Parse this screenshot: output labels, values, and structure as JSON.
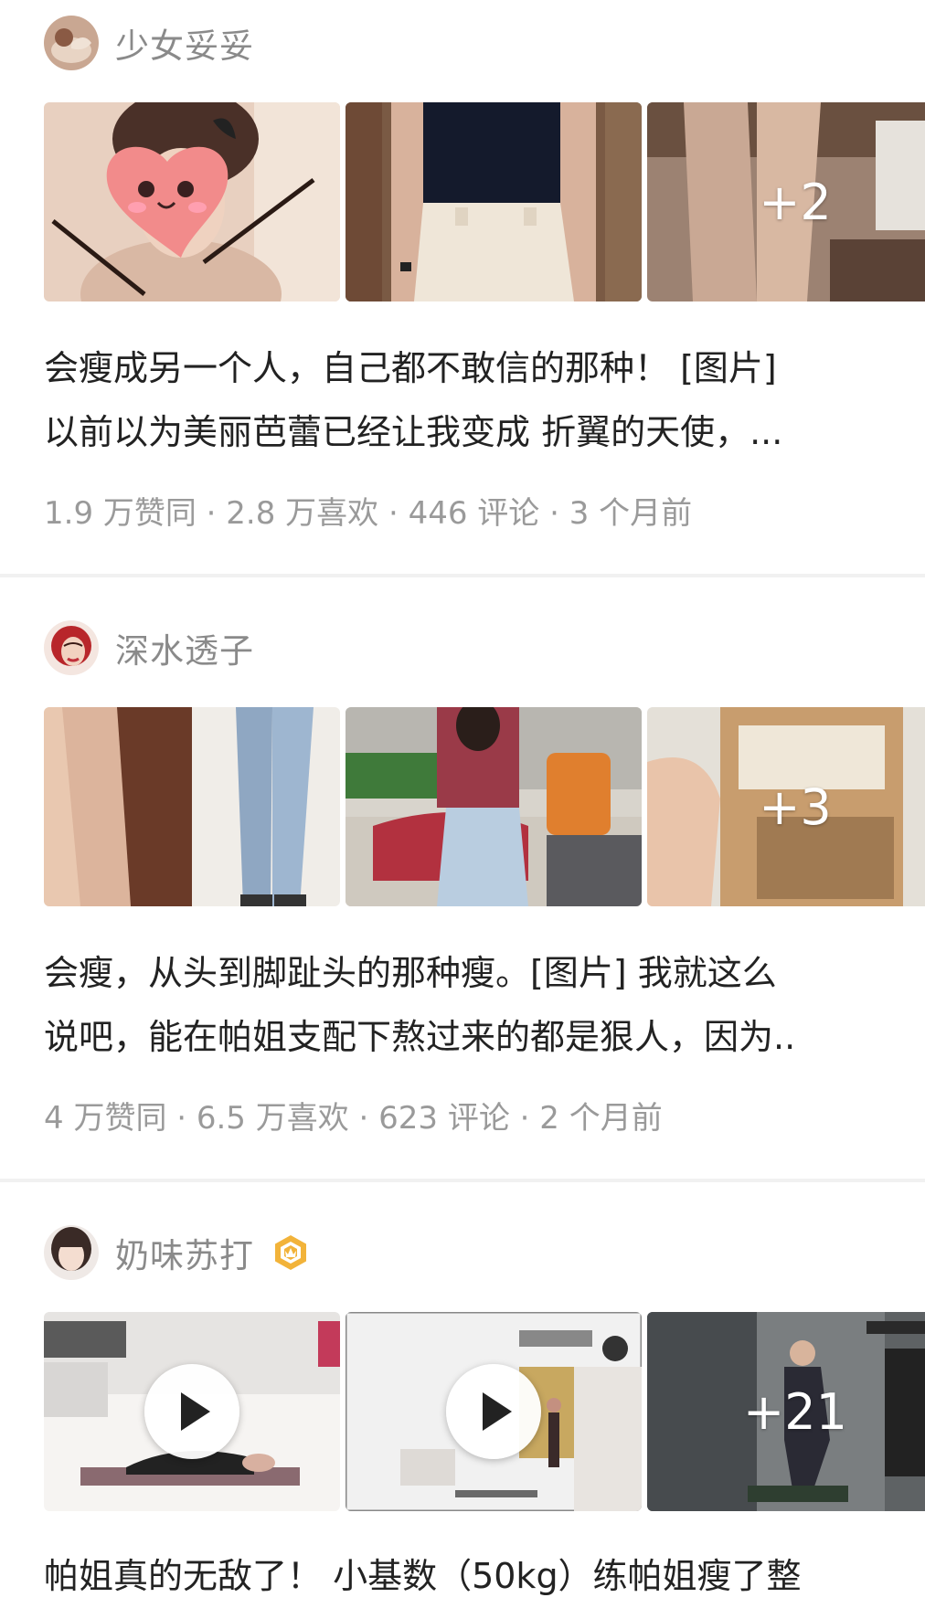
{
  "posts": [
    {
      "author": "少女妥妥",
      "more": "+2",
      "line1": "会瘦成另一个人，自己都不敢信的那种！ [图片]",
      "line2": "以前以为美丽芭蕾已经让我变成 折翼的天使，...",
      "stats": "1.9 万赞同 · 2.8 万喜欢 · 446 评论 · 3 个月前"
    },
    {
      "author": "深水透子",
      "more": "+3",
      "line1": "会瘦，从头到脚趾头的那种瘦。[图片] 我就这么",
      "line2": "说吧，能在帕姐支配下熬过来的都是狠人，因为..",
      "stats": "4 万赞同 · 6.5 万喜欢 · 623 评论 · 2 个月前"
    },
    {
      "author": "奶味苏打",
      "more": "+21",
      "line1": "帕姐真的无敌了！ 小基数（50kg）练帕姐瘦了整"
    }
  ]
}
